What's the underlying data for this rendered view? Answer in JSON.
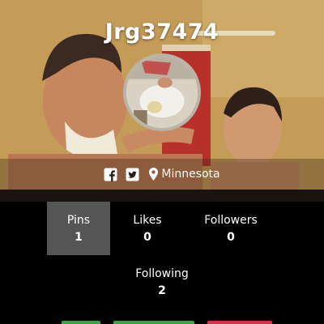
{
  "profile": {
    "username": "Jrg37474",
    "location": "Minnesota"
  },
  "icons": {
    "facebook": "facebook-icon",
    "twitter": "twitter-icon",
    "location": "map-marker-icon"
  },
  "stats": [
    {
      "label": "Pins",
      "value": "1",
      "active": true
    },
    {
      "label": "Likes",
      "value": "0",
      "active": false
    },
    {
      "label": "Followers",
      "value": "0",
      "active": false
    },
    {
      "label": "Following",
      "value": "2",
      "active": false
    }
  ],
  "colors": {
    "active_stat_bg": "#555555",
    "background": "#000000",
    "green_button": "#3fa04a",
    "red_button": "#d2334a"
  }
}
